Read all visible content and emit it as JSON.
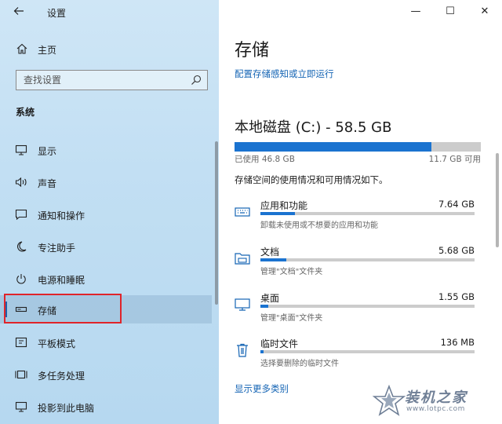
{
  "app": {
    "title": "设置"
  },
  "window": {
    "minimize": "—",
    "maximize": "☐",
    "close": "✕"
  },
  "sidebar": {
    "home_label": "主页",
    "search_placeholder": "查找设置",
    "section_title": "系统",
    "items": [
      {
        "label": "显示",
        "icon": "display-icon"
      },
      {
        "label": "声音",
        "icon": "sound-icon"
      },
      {
        "label": "通知和操作",
        "icon": "notification-icon"
      },
      {
        "label": "专注助手",
        "icon": "moon-icon"
      },
      {
        "label": "电源和睡眠",
        "icon": "power-icon"
      },
      {
        "label": "存储",
        "icon": "storage-icon",
        "selected": true
      },
      {
        "label": "平板模式",
        "icon": "tablet-icon"
      },
      {
        "label": "多任务处理",
        "icon": "multitask-icon"
      },
      {
        "label": "投影到此电脑",
        "icon": "project-icon"
      }
    ]
  },
  "main": {
    "title": "存储",
    "config_link": "配置存储感知或立即运行",
    "disk": {
      "title": "本地磁盘 (C:) - 58.5 GB",
      "used_label": "已使用 46.8 GB",
      "free_label": "11.7 GB 可用",
      "used_fraction": 0.8
    },
    "description": "存储空间的使用情况和可用情况如下。",
    "categories": [
      {
        "name": "应用和功能",
        "size": "7.64 GB",
        "sub": "卸载未使用或不想要的应用和功能",
        "fraction": 0.16,
        "icon": "keyboard-icon"
      },
      {
        "name": "文档",
        "size": "5.68 GB",
        "sub": "管理\"文档\"文件夹",
        "fraction": 0.12,
        "icon": "folder-icon"
      },
      {
        "name": "桌面",
        "size": "1.55 GB",
        "sub": "管理\"桌面\"文件夹",
        "fraction": 0.035,
        "icon": "monitor-icon"
      },
      {
        "name": "临时文件",
        "size": "136 MB",
        "sub": "选择要删除的临时文件",
        "fraction": 0.005,
        "icon": "trash-icon"
      }
    ],
    "more_link": "显示更多类别"
  },
  "watermark": {
    "name": "装机之家",
    "url": "www.lotpc.com"
  },
  "colors": {
    "accent": "#1b73d0",
    "link": "#1464b4",
    "highlight": "#e0242a"
  }
}
